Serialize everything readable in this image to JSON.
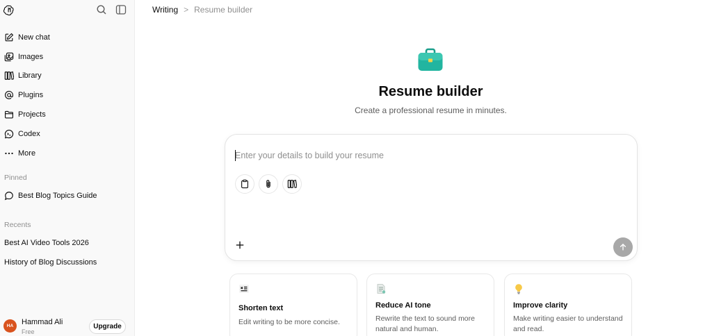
{
  "sidebar": {
    "nav": [
      {
        "label": "New chat",
        "icon": "edit-icon"
      },
      {
        "label": "Images",
        "icon": "images-icon"
      },
      {
        "label": "Library",
        "icon": "library-icon"
      },
      {
        "label": "Plugins",
        "icon": "at-icon"
      },
      {
        "label": "Projects",
        "icon": "folder-icon"
      },
      {
        "label": "Codex",
        "icon": "codex-icon"
      },
      {
        "label": "More",
        "icon": "more-icon"
      }
    ],
    "pinned_title": "Pinned",
    "pinned": [
      {
        "label": "Best Blog Topics Guide",
        "icon": "chat-bubble-icon"
      }
    ],
    "recents_title": "Recents",
    "recents": [
      {
        "label": "Best AI Video Tools 2026"
      },
      {
        "label": "History of Blog Discussions"
      }
    ],
    "user": {
      "initials": "HA",
      "name": "Hammad Ali",
      "plan": "Free",
      "upgrade_label": "Upgrade"
    }
  },
  "breadcrumb": {
    "parent": "Writing",
    "separator": ">",
    "current": "Resume builder"
  },
  "hero": {
    "icon": "briefcase-icon",
    "title": "Resume builder",
    "subtitle": "Create a professional resume in minutes."
  },
  "composer": {
    "placeholder": "Enter your details to build your resume",
    "value": "",
    "tools": [
      "clipboard-icon",
      "paperclip-icon",
      "library-icon"
    ]
  },
  "cards": [
    {
      "icon": "shorten-icon",
      "title": "Shorten text",
      "description": "Edit writing to be more concise."
    },
    {
      "icon": "document-icon",
      "title": "Reduce AI tone",
      "description": "Rewrite the text to sound more natural and human."
    },
    {
      "icon": "lightbulb-icon",
      "title": "Improve clarity",
      "description": "Make writing easier to understand and read."
    }
  ],
  "colors": {
    "accent_teal": "#22b5a0",
    "send_button": "#a8a8a8",
    "avatar": "#d9531e"
  }
}
